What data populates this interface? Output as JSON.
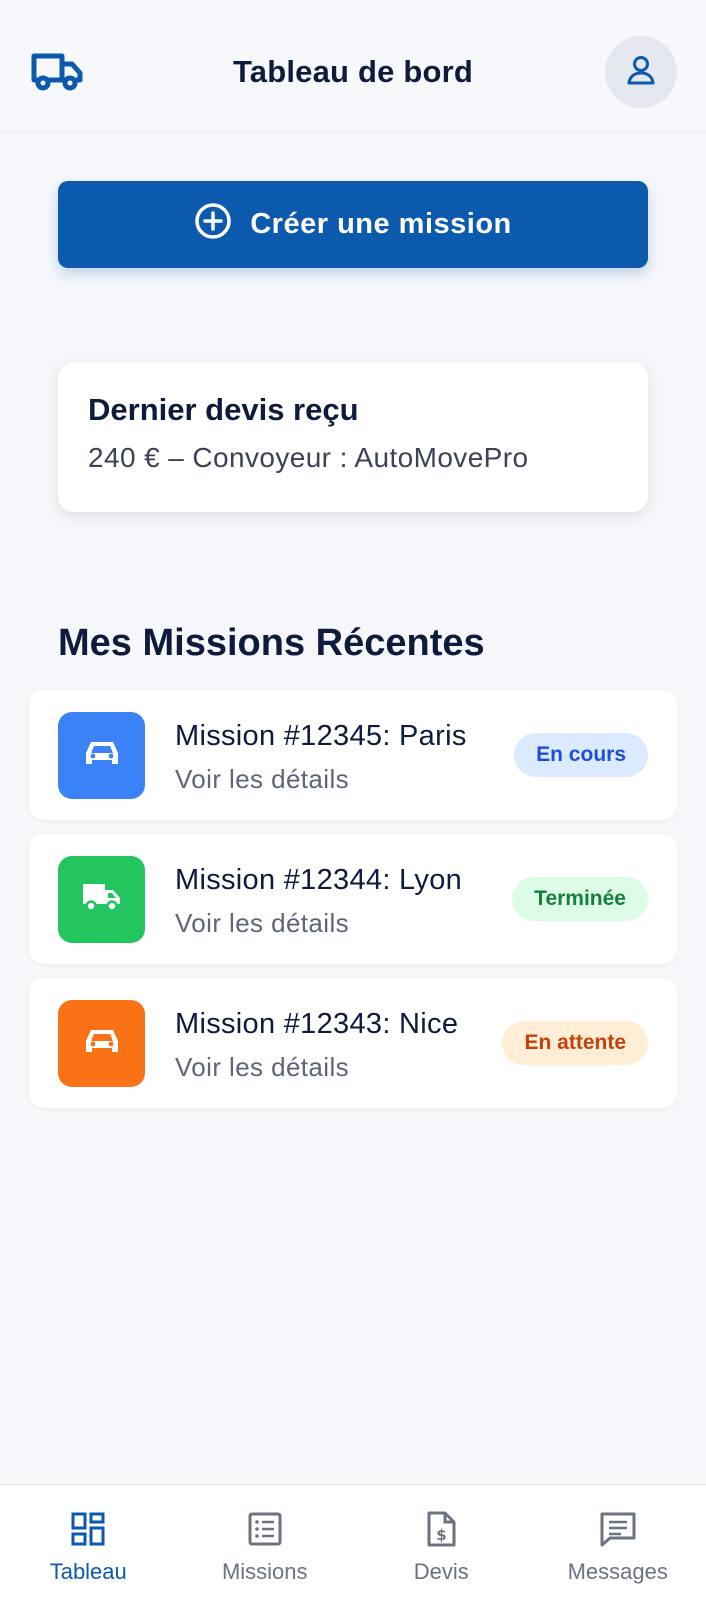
{
  "header": {
    "title": "Tableau de bord",
    "logo_icon": "truck-icon",
    "profile_icon": "user-icon"
  },
  "create_button": {
    "label": "Créer une mission",
    "icon": "plus-circle-icon"
  },
  "quote_card": {
    "title": "Dernier devis reçu",
    "text": "240 € – Convoyeur : AutoMovePro"
  },
  "recent": {
    "title": "Mes Missions Récentes",
    "missions": [
      {
        "title": "Mission #12345: Paris",
        "subtitle": "Voir les détails",
        "status": "En cours",
        "icon": "car-icon",
        "icon_bg": "#3b82f6",
        "badge_bg": "#dbeafe",
        "badge_fg": "#1d4ed8"
      },
      {
        "title": "Mission #12344: Lyon",
        "subtitle": "Voir les détails",
        "status": "Terminée",
        "icon": "truck-icon",
        "icon_bg": "#22c55e",
        "badge_bg": "#dcfce7",
        "badge_fg": "#15803d"
      },
      {
        "title": "Mission #12343: Nice",
        "subtitle": "Voir les détails",
        "status": "En attente",
        "icon": "car-icon",
        "icon_bg": "#f97316",
        "badge_bg": "#ffedd5",
        "badge_fg": "#c2410c"
      }
    ]
  },
  "nav": {
    "items": [
      {
        "label": "Tableau",
        "icon": "dashboard-icon",
        "active": true
      },
      {
        "label": "Missions",
        "icon": "list-icon",
        "active": false
      },
      {
        "label": "Devis",
        "icon": "invoice-icon",
        "active": false
      },
      {
        "label": "Messages",
        "icon": "message-icon",
        "active": false
      }
    ]
  },
  "colors": {
    "primary": "#0b5aad",
    "background": "#f5f7fa",
    "text": "#0f1b3d"
  }
}
